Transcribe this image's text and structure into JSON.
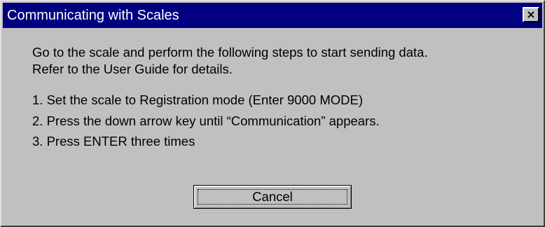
{
  "window": {
    "title": "Communicating with Scales",
    "close_glyph": "×"
  },
  "message": {
    "intro_line1": "Go to the scale and perform the following steps to start sending data.",
    "intro_line2": "Refer to the User Guide for details.",
    "steps": [
      "1. Set the scale to Registration mode (Enter 9000 MODE)",
      "2. Press the down arrow key until “Communication” appears.",
      "3. Press ENTER three times"
    ]
  },
  "buttons": {
    "cancel_label": "Cancel"
  }
}
